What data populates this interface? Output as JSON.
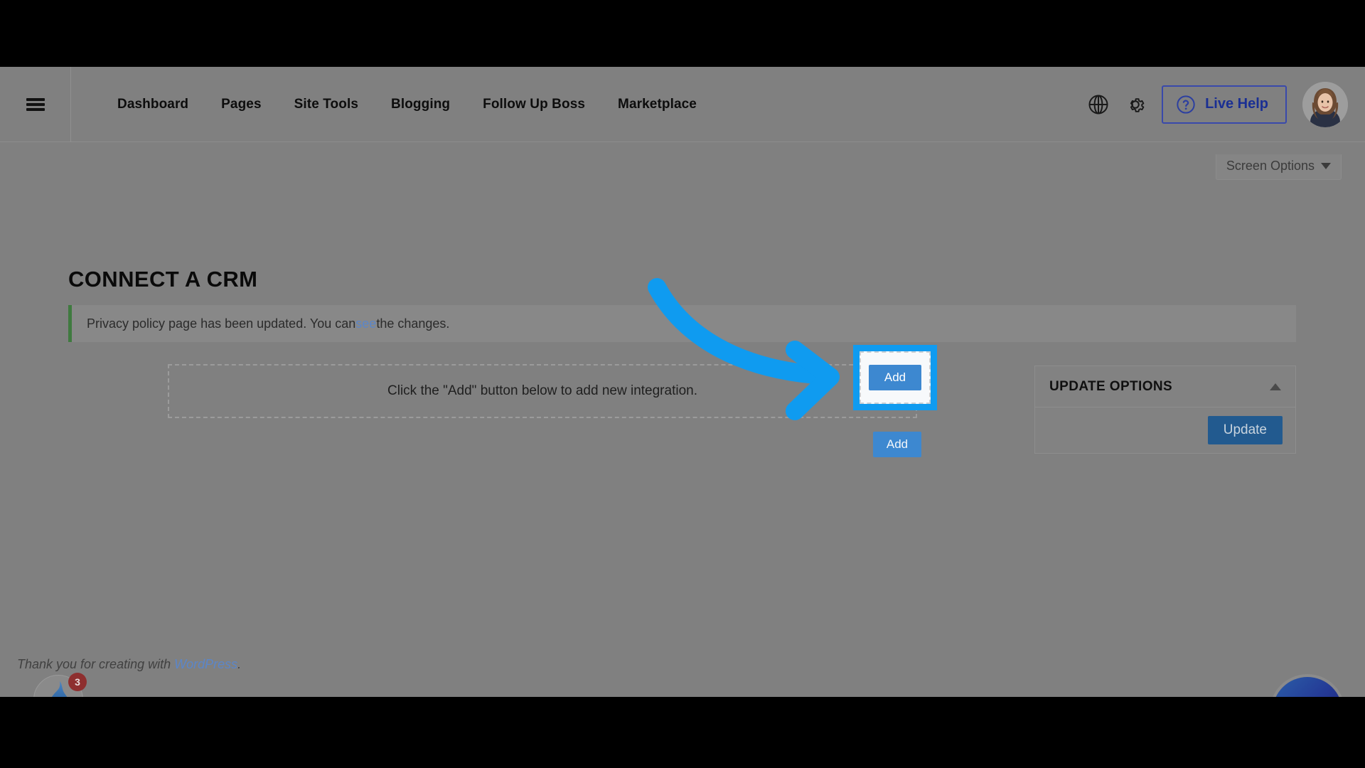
{
  "header": {
    "menu_icon": "hamburger-menu-icon",
    "nav": [
      {
        "label": "Dashboard"
      },
      {
        "label": "Pages"
      },
      {
        "label": "Site Tools"
      },
      {
        "label": "Blogging"
      },
      {
        "label": "Follow Up Boss"
      },
      {
        "label": "Marketplace"
      }
    ],
    "globe_icon": "globe-icon",
    "gear_icon": "gear-icon",
    "live_help": {
      "label": "Live Help",
      "icon": "question-mark-circle-icon"
    },
    "avatar": "user-avatar"
  },
  "screen_options": {
    "label": "Screen Options",
    "chevron": "chevron-down-icon"
  },
  "page": {
    "title": "CONNECT A CRM",
    "notice": {
      "text_before": "Privacy policy page has been updated. You can ",
      "link": "see",
      "text_after": " the changes."
    },
    "empty_state": {
      "text": "Click the \"Add\" button below to add new integration."
    },
    "add_button": {
      "label": "Add"
    }
  },
  "update_options": {
    "title": "UPDATE OPTIONS",
    "collapse_icon": "chevron-up-icon",
    "button_label": "Update"
  },
  "footer": {
    "credit_before": "Thank you for creating with ",
    "credit_link": "WordPress",
    "credit_after": ".",
    "notification_count": "3",
    "flame_icon": "flame-droplet-icon",
    "chat_icon": "sparkle-chat-icon"
  },
  "annotation": {
    "highlight_label": "Add",
    "arrow_icon": "curved-arrow-right-icon",
    "accent_color": "#0f9bf0"
  },
  "colors": {
    "overlay": "#000000",
    "surface": "#808080",
    "notice_accent": "#3f7a3f",
    "primary_button": "#225a8f",
    "add_button": "#3d88d0",
    "link": "#5b86c9",
    "live_help": "#1a2f93"
  }
}
